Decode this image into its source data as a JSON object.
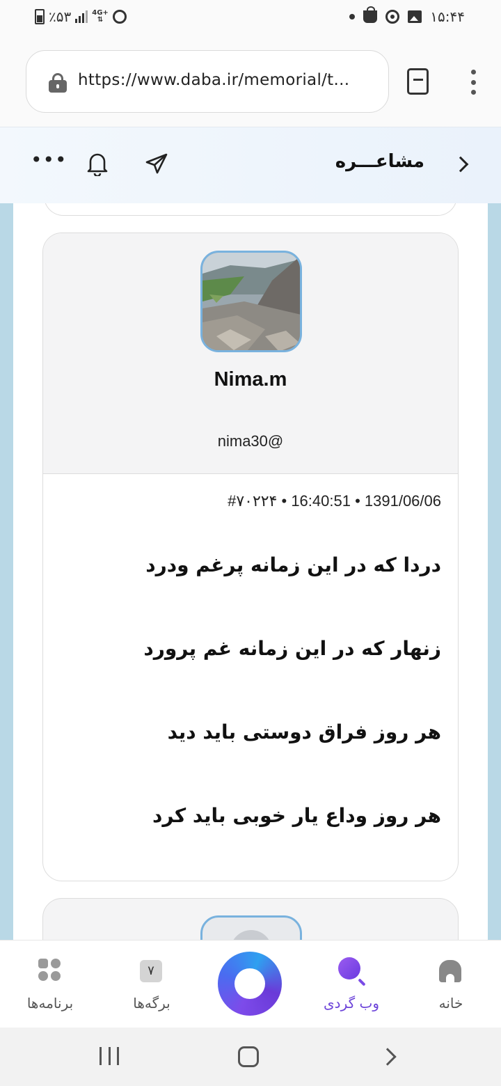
{
  "status_bar": {
    "battery": "٪۵۳",
    "network": "4G+",
    "time": "۱۵:۴۴"
  },
  "browser": {
    "url": "https://www.daba.ir/memorial/t..."
  },
  "site_header": {
    "title": "مشاعـــره"
  },
  "post": {
    "username": "Nima.m",
    "handle": "nima30@",
    "meta": "#۷۰۲۲۴  •  16:40:51 • 1391/06/06",
    "verses": [
      "دردا که در این زمانه پرغم ودرد",
      "زنهار که در این زمانه غم پرورد",
      "هر روز فراق دوستی باید دید",
      "هر روز وداع یار خوبی باید کرد"
    ]
  },
  "bottom_nav": {
    "home_label": "خانه",
    "web_label": "وب گردی",
    "tabs_label": "برگه‌ها",
    "tabs_count": "۷",
    "apps_label": "برنامه‌ها"
  }
}
